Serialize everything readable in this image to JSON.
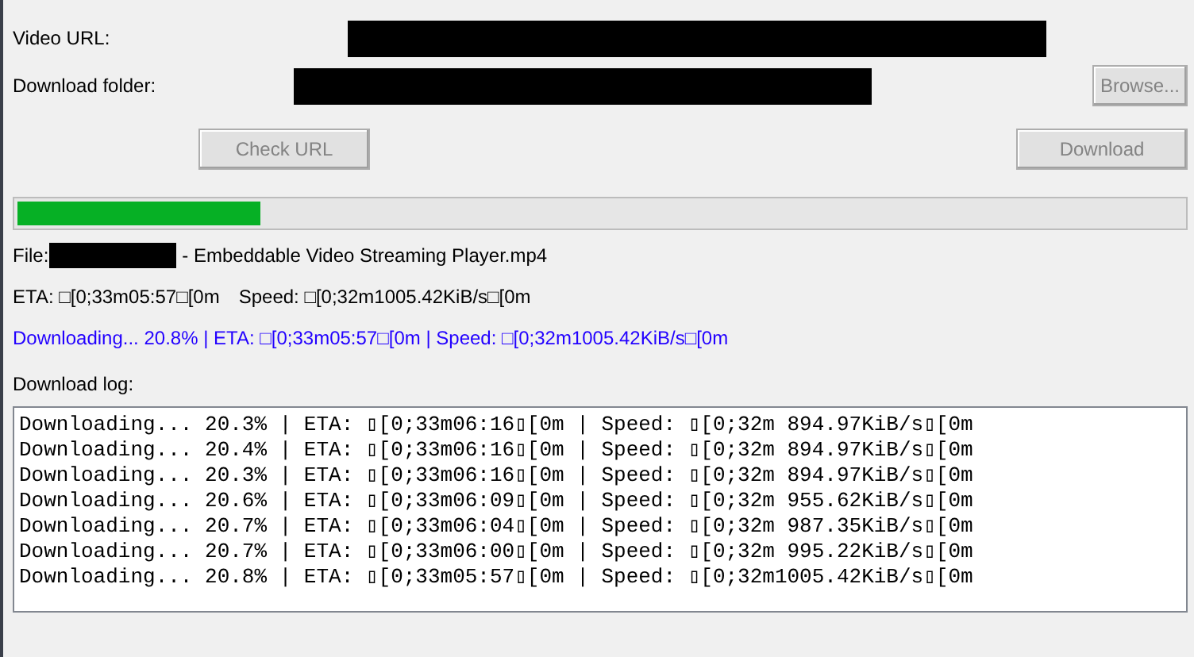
{
  "form": {
    "url_label": "Video URL:",
    "folder_label": "Download folder:",
    "browse": {
      "label": "Browse...",
      "disabled": true
    }
  },
  "actions": [
    {
      "label": "Check URL",
      "disabled": true
    },
    {
      "label": "Download",
      "disabled": true
    }
  ],
  "progress": {
    "level": 0.208
  },
  "file": {
    "prefix": "File:",
    "name": "- Embeddable Video Streaming Player.mp4"
  },
  "eta_line": {
    "eta": "ETA: □[0;33m05:57□[0m",
    "speed": "Speed: □[0;32m1005.42KiB/s□[0m"
  },
  "status": "Downloading... 20.8% | ETA: □[0;33m05:57□[0m | Speed: □[0;32m1005.42KiB/s□[0m",
  "log": {
    "label": "Download log:",
    "lines": [
      "Downloading... 20.3% | ETA: ▯[0;33m06:16▯[0m | Speed: ▯[0;32m 894.97KiB/s▯[0m",
      "Downloading... 20.4% | ETA: ▯[0;33m06:16▯[0m | Speed: ▯[0;32m 894.97KiB/s▯[0m",
      "Downloading... 20.3% | ETA: ▯[0;33m06:16▯[0m | Speed: ▯[0;32m 894.97KiB/s▯[0m",
      "Downloading... 20.6% | ETA: ▯[0;33m06:09▯[0m | Speed: ▯[0;32m 955.62KiB/s▯[0m",
      "Downloading... 20.7% | ETA: ▯[0;33m06:04▯[0m | Speed: ▯[0;32m 987.35KiB/s▯[0m",
      "Downloading... 20.7% | ETA: ▯[0;33m06:00▯[0m | Speed: ▯[0;32m 995.22KiB/s▯[0m",
      "Downloading... 20.8% | ETA: ▯[0;33m05:57▯[0m | Speed: ▯[0;32m1005.42KiB/s▯[0m"
    ]
  }
}
